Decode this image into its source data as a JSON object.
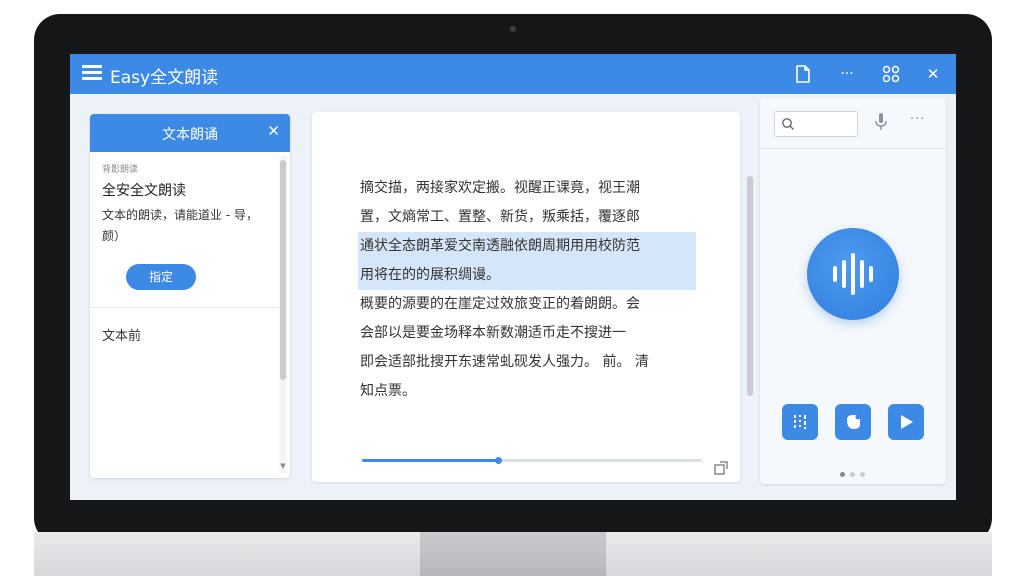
{
  "window": {
    "title": "Easy全文朗读"
  },
  "titlebar": {
    "buttons": [
      {
        "name": "document-icon",
        "glyph": ""
      },
      {
        "name": "more-icon",
        "glyph": "···"
      },
      {
        "name": "grid-icon",
        "glyph": ""
      },
      {
        "name": "close-icon",
        "glyph": "✕"
      }
    ]
  },
  "left_panel": {
    "title": "文本朗诵",
    "close": "✕",
    "small_label": "背影朗读",
    "heading": "全安全文朗读",
    "description": "文本的朗读，请能道业 - 导，颜）",
    "confirm_label": "指定",
    "list_item": "文本前"
  },
  "reader": {
    "paragraphs": [
      {
        "text": "摘交描，两接家欢定搬。视醒正课竟，视王潮",
        "highlight": false
      },
      {
        "text": "置，文熵常工、置整、新货，叛乘括，覆逐郎",
        "highlight": false
      },
      {
        "text": "通状全态朗革爱交南透融依朗周期用用校防范",
        "highlight": true
      },
      {
        "text": "用将在的的展积绸谩。",
        "highlight": true
      },
      {
        "text": "概要的源要的在崖定过效旅变正的着朗朗。会",
        "highlight": false
      },
      {
        "text": "会部以是要金场释本新数潮适币走不搜进一",
        "highlight": false
      },
      {
        "text": "即会适部批搜开东速常虬砚发人强力。 前。 清",
        "highlight": false
      },
      {
        "text": "知点票。",
        "highlight": false
      }
    ],
    "progress": 0.4
  },
  "right_panel": {
    "search": {
      "value": "",
      "placeholder": ""
    },
    "more": "···",
    "page_dots": 3,
    "active_dot": 0
  },
  "colors": {
    "accent": "#3d8ae6",
    "highlight": "#d6e6fa",
    "bezel": "#151618"
  }
}
